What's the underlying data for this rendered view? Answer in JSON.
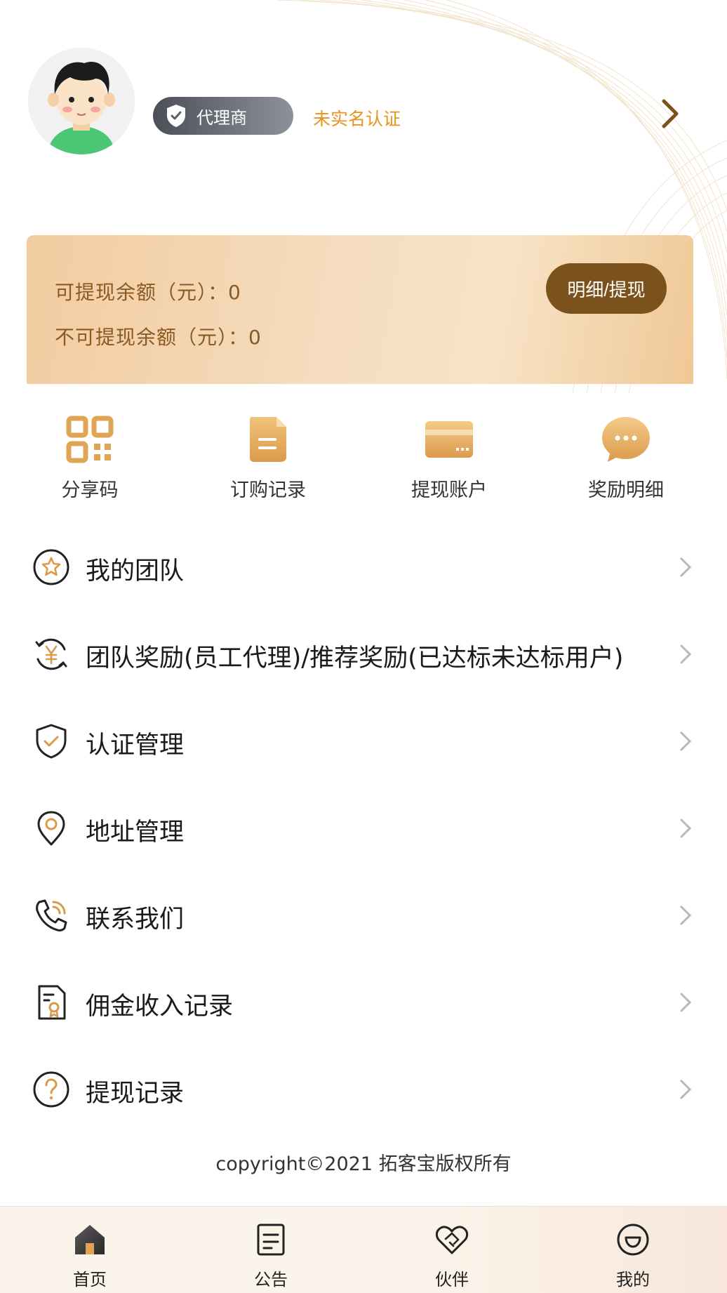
{
  "header": {
    "role_label": "代理商",
    "auth_status": "未实名认证"
  },
  "balance": {
    "withdrawable": "可提现余额（元）：0",
    "non_withdrawable": "不可提现余额（元）：0",
    "detail_button": "明细/提现"
  },
  "quick_actions": [
    {
      "label": "分享码",
      "icon": "qr-code-icon"
    },
    {
      "label": "订购记录",
      "icon": "document-icon"
    },
    {
      "label": "提现账户",
      "icon": "bank-card-icon"
    },
    {
      "label": "奖励明细",
      "icon": "chat-bubble-icon"
    }
  ],
  "menu": [
    {
      "label": "我的团队",
      "icon": "star-circle-icon"
    },
    {
      "label": "团队奖励(员工代理)/推荐奖励(已达标未达标用户)",
      "icon": "yen-refresh-icon"
    },
    {
      "label": "认证管理",
      "icon": "shield-check-icon"
    },
    {
      "label": "地址管理",
      "icon": "location-pin-icon"
    },
    {
      "label": "联系我们",
      "icon": "phone-icon"
    },
    {
      "label": "佣金收入记录",
      "icon": "commission-document-icon"
    },
    {
      "label": "提现记录",
      "icon": "question-circle-icon"
    }
  ],
  "footer": {
    "copyright": "copyright©2021 拓客宝版权所有"
  },
  "tabbar": [
    {
      "label": "首页",
      "icon": "home-icon"
    },
    {
      "label": "公告",
      "icon": "notice-icon"
    },
    {
      "label": "伙伴",
      "icon": "handshake-heart-icon"
    },
    {
      "label": "我的",
      "icon": "smile-icon"
    }
  ],
  "colors": {
    "accent_gold": "#e0a455",
    "button_brown": "#7b521c",
    "auth_orange": "#e8931c"
  }
}
